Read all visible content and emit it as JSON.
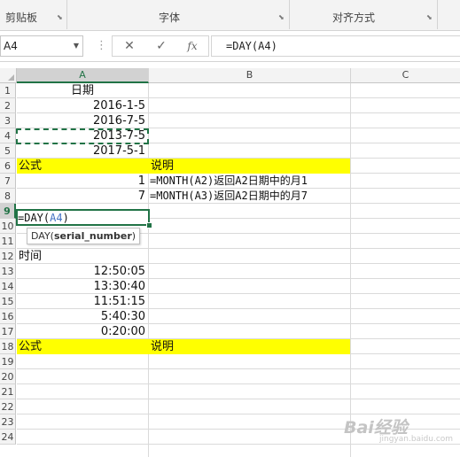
{
  "ribbon": {
    "groups": [
      {
        "label": "剪贴板"
      },
      {
        "label": "字体"
      },
      {
        "label": "对齐方式"
      }
    ]
  },
  "formula_bar": {
    "name_box": "A4",
    "cancel_symbol": "✕",
    "enter_symbol": "✓",
    "function_symbol": "fx",
    "formula": "=DAY(A4)"
  },
  "columns": [
    "A",
    "B",
    "C"
  ],
  "selected_column": "A",
  "rows": [
    "1",
    "2",
    "3",
    "4",
    "5",
    "6",
    "7",
    "8",
    "9",
    "10",
    "11",
    "12",
    "13",
    "14",
    "15",
    "16",
    "17",
    "18",
    "19",
    "20",
    "21",
    "22",
    "23",
    "24"
  ],
  "selected_row": "9",
  "cells": {
    "a1": "日期",
    "a2": "2016-1-5",
    "a3": "2016-7-5",
    "a4": "2013-7-5",
    "a5": "2017-5-1",
    "a6": "公式",
    "b6": "说明",
    "a7": "1",
    "b7": "=MONTH(A2)返回A2日期中的月1",
    "a8": "7",
    "b8": "=MONTH(A3)返回A2日期中的月7",
    "a9_prefix": "=DAY(",
    "a9_ref": "A4",
    "a9_suffix": ")",
    "a11": "时间",
    "a12": "12:50:05",
    "a13": "13:30:40",
    "a14": "11:51:15",
    "a15": "5:40:30",
    "a16": "0:20:00",
    "a17": "公式",
    "b17": "说明"
  },
  "tooltip": {
    "func": "DAY(",
    "arg": "serial_number",
    "close": ")"
  },
  "watermark": {
    "brand": "Bai经验",
    "url": "jingyan.baidu.com"
  },
  "colors": {
    "highlight": "#ffff00",
    "accent": "#217346",
    "reference": "#4472c4"
  }
}
